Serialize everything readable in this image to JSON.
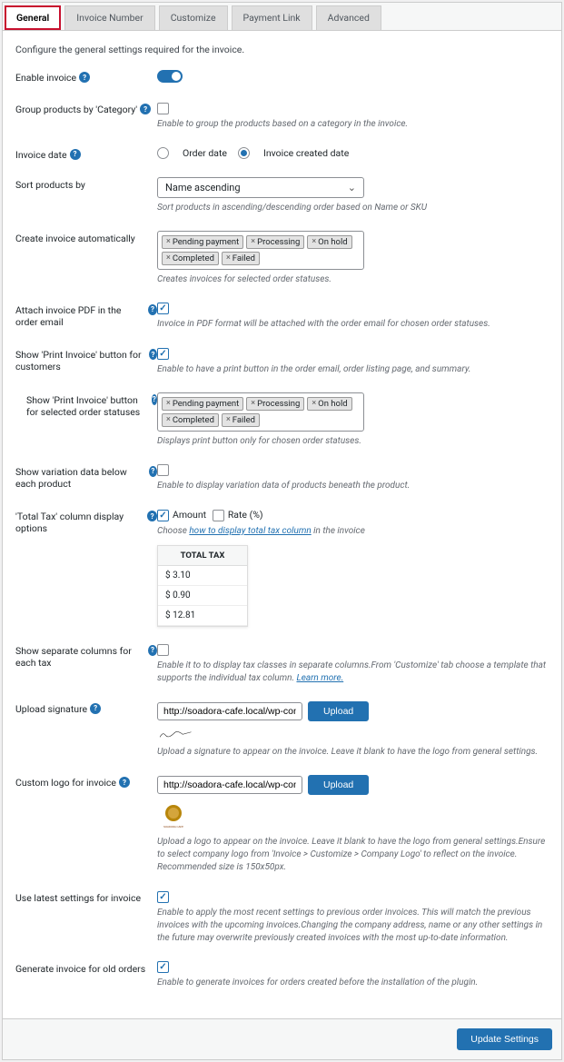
{
  "tabs": [
    "General",
    "Invoice Number",
    "Customize",
    "Payment Link",
    "Advanced"
  ],
  "intro": "Configure the general settings required for the invoice.",
  "enable_invoice": {
    "label": "Enable invoice"
  },
  "group_products": {
    "label": "Group products by 'Category'",
    "hint": "Enable to group the products based on a category in the invoice."
  },
  "invoice_date": {
    "label": "Invoice date",
    "opts": [
      "Order date",
      "Invoice created date"
    ]
  },
  "sort_products": {
    "label": "Sort products by",
    "value": "Name ascending",
    "hint": "Sort products in ascending/descending order based on Name or SKU"
  },
  "create_auto": {
    "label": "Create invoice automatically",
    "tags": [
      "Pending payment",
      "Processing",
      "On hold",
      "Completed",
      "Failed"
    ],
    "hint": "Creates invoices for selected order statuses."
  },
  "attach_pdf": {
    "label": "Attach invoice PDF in the order email",
    "hint": "Invoice in PDF format will be attached with the order email for chosen order statuses."
  },
  "show_print": {
    "label": "Show 'Print Invoice' button for customers",
    "hint": "Enable to have a print button in the order email, order listing page, and summary."
  },
  "print_statuses": {
    "label": "Show 'Print Invoice' button for selected order statuses",
    "tags": [
      "Pending payment",
      "Processing",
      "On hold",
      "Completed",
      "Failed"
    ],
    "hint": "Displays print button only for chosen order statuses."
  },
  "variation": {
    "label": "Show variation data below each product",
    "hint": "Enable to display variation data of products beneath the product."
  },
  "total_tax": {
    "label": "'Total Tax' column display options",
    "opt_amount": "Amount",
    "opt_rate": "Rate (%)",
    "hint_pre": "Choose ",
    "hint_link": "how to display total tax column",
    "hint_post": " in the invoice",
    "table_header": "TOTAL TAX",
    "table_rows": [
      "$ 3.10",
      "$ 0.90",
      "$ 12.81"
    ]
  },
  "sep_cols": {
    "label": "Show separate columns for each tax",
    "hint_pre": "Enable it to to display tax classes in separate columns.From 'Customize' tab choose a template that supports the individual tax column. ",
    "hint_link": "Learn more."
  },
  "signature": {
    "label": "Upload signature",
    "value": "http://soadora-cafe.local/wp-content/up",
    "btn": "Upload",
    "hint": "Upload a signature to appear on the invoice. Leave it blank to have the logo from general settings."
  },
  "logo": {
    "label": "Custom logo for invoice",
    "value": "http://soadora-cafe.local/wp-content/up",
    "btn": "Upload",
    "hint": "Upload a logo to appear on the invoice. Leave it blank to have the logo from general settings.Ensure to select company logo from 'Invoice > Customize > Company Logo' to reflect on the invoice. Recommended size is 150x50px."
  },
  "latest": {
    "label": "Use latest settings for invoice",
    "hint": "Enable to apply the most recent settings to previous order invoices. This will match the previous invoices with the upcoming invoices.Changing the company address, name or any other settings in the future may overwrite previously created invoices with the most up-to-date information."
  },
  "old_orders": {
    "label": "Generate invoice for old orders",
    "hint": "Enable to generate invoices for orders created before the installation of the plugin."
  },
  "footer_btn": "Update Settings"
}
